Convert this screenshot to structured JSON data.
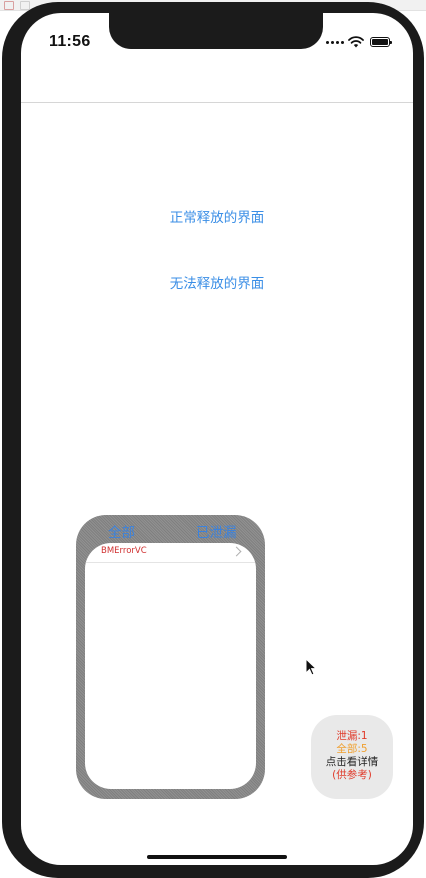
{
  "status_bar": {
    "time": "11:56",
    "battery_level": 1.0
  },
  "main": {
    "links": [
      {
        "label": "正常释放的界面"
      },
      {
        "label": "无法释放的界面"
      }
    ]
  },
  "leak_panel": {
    "tabs": {
      "all": "全部",
      "leaked": "已泄漏"
    },
    "rows": [
      {
        "label": "BMErrorVC"
      }
    ]
  },
  "floating_bubble": {
    "leaked": "泄漏:1",
    "total": "全部:5",
    "hint": "点击看详情",
    "note": "(供参考)"
  },
  "colors": {
    "link_blue": "#3a8ee6",
    "error_red": "#d03030",
    "total_orange": "#f0a030"
  },
  "icons": [
    "signal-icon",
    "wifi-icon",
    "battery-icon",
    "chevron-right-icon",
    "mouse-cursor-icon"
  ]
}
